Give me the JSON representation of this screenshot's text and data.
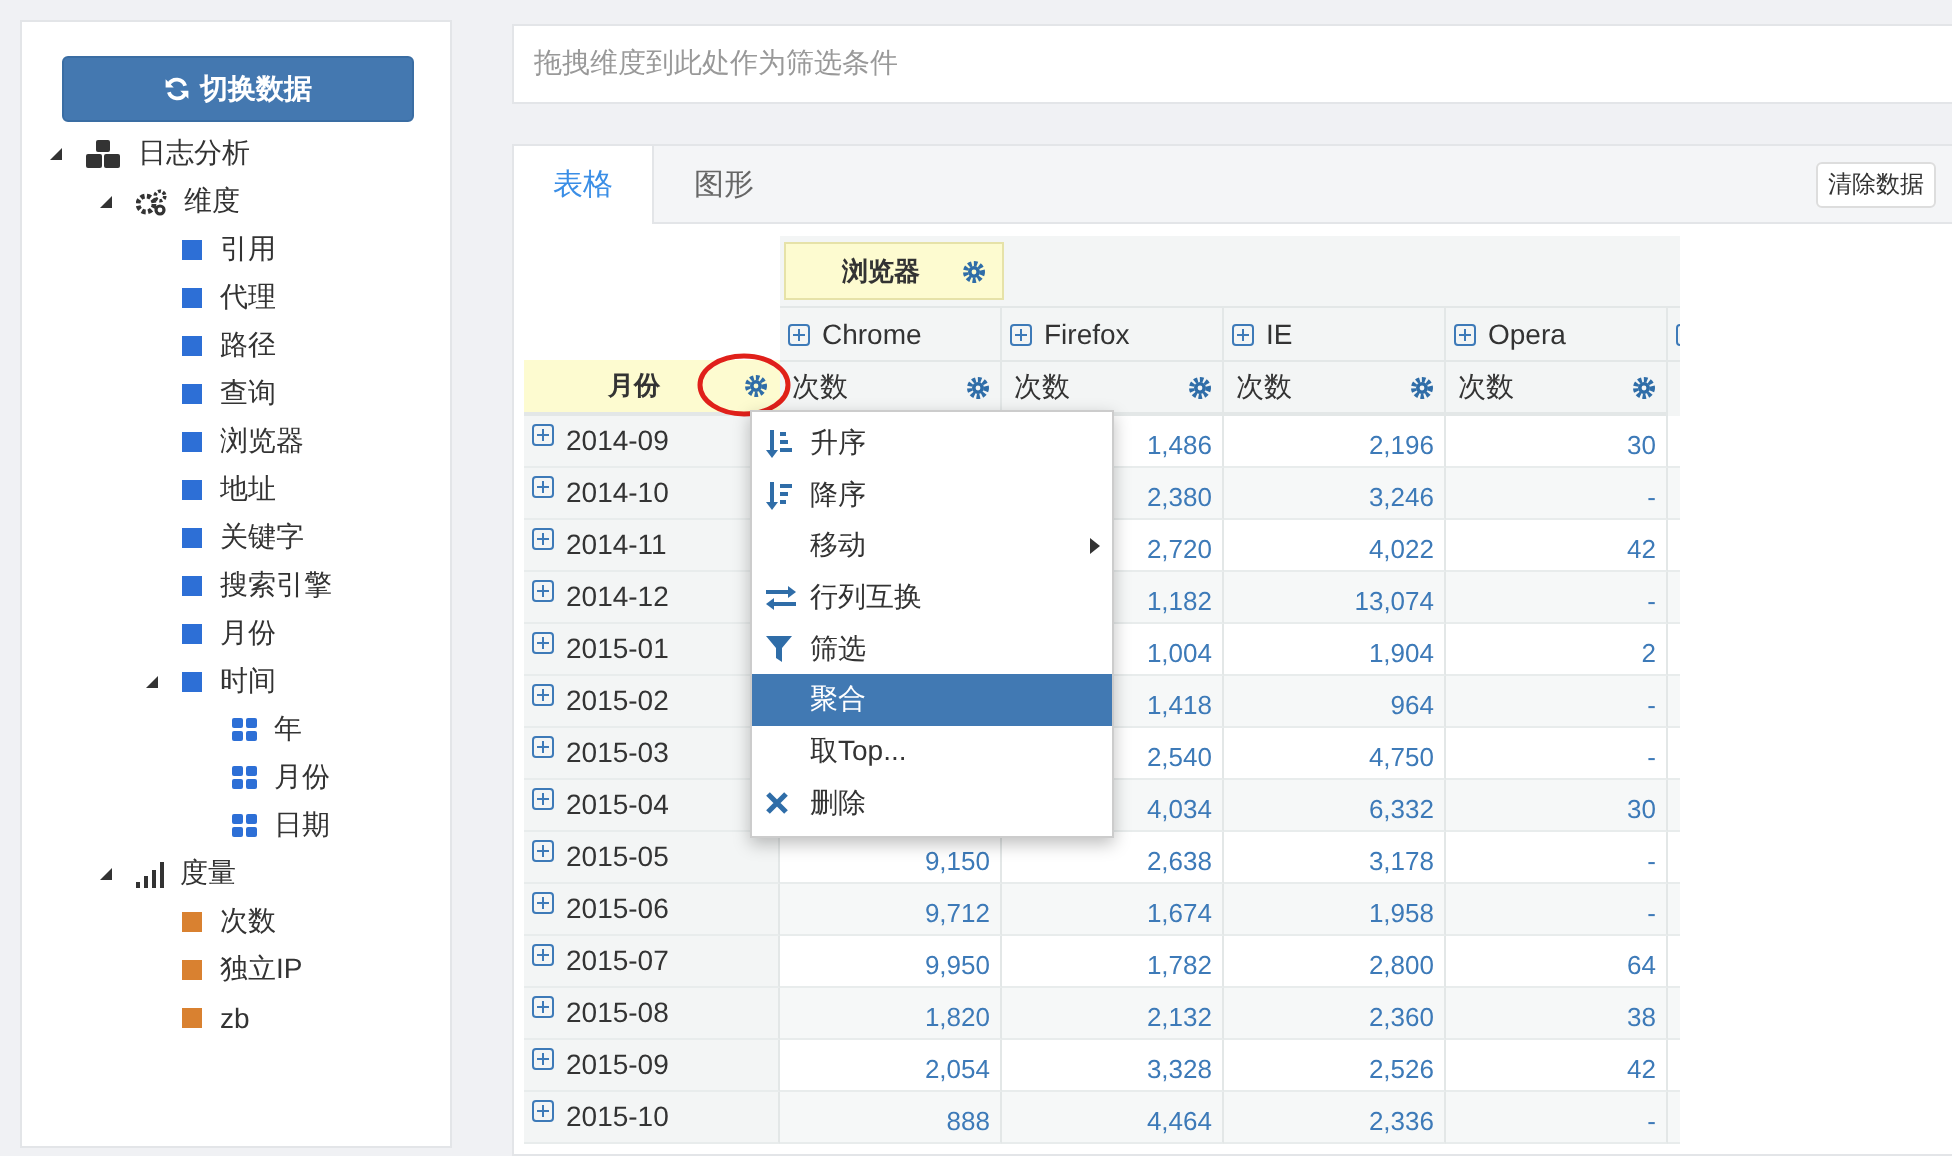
{
  "sidebar": {
    "switch_button": "切换数据",
    "tree": [
      {
        "label": "日志分析",
        "kind": "cube",
        "expanded": true,
        "children": [
          {
            "label": "维度",
            "kind": "gears",
            "expanded": true,
            "children": [
              {
                "label": "引用",
                "kind": "dimension"
              },
              {
                "label": "代理",
                "kind": "dimension"
              },
              {
                "label": "路径",
                "kind": "dimension"
              },
              {
                "label": "查询",
                "kind": "dimension"
              },
              {
                "label": "浏览器",
                "kind": "dimension"
              },
              {
                "label": "地址",
                "kind": "dimension"
              },
              {
                "label": "关键字",
                "kind": "dimension"
              },
              {
                "label": "搜索引擎",
                "kind": "dimension"
              },
              {
                "label": "月份",
                "kind": "dimension"
              },
              {
                "label": "时间",
                "kind": "dimension",
                "expanded": true,
                "children": [
                  {
                    "label": "年",
                    "kind": "level"
                  },
                  {
                    "label": "月份",
                    "kind": "level"
                  },
                  {
                    "label": "日期",
                    "kind": "level"
                  }
                ]
              }
            ]
          },
          {
            "label": "度量",
            "kind": "bars",
            "expanded": true,
            "children": [
              {
                "label": "次数",
                "kind": "measure"
              },
              {
                "label": "独立IP",
                "kind": "measure"
              },
              {
                "label": "zb",
                "kind": "measure"
              }
            ]
          }
        ]
      }
    ]
  },
  "filter_bar": {
    "placeholder": "拖拽维度到此处作为筛选条件"
  },
  "tabs": [
    {
      "label": "表格",
      "selected": true
    },
    {
      "label": "图形",
      "selected": false
    }
  ],
  "clear_button": "清除数据",
  "pivot": {
    "column_dimension": "浏览器",
    "row_dimension": "月份",
    "columns": [
      {
        "name": "Chrome",
        "measure": "次数"
      },
      {
        "name": "Firefox",
        "measure": "次数"
      },
      {
        "name": "IE",
        "measure": "次数"
      },
      {
        "name": "Opera",
        "measure": "次数"
      }
    ],
    "rows": [
      {
        "label": "2014-09",
        "values": [
          "1,486",
          "2,196",
          "30"
        ]
      },
      {
        "label": "2014-10",
        "values": [
          "2,380",
          "3,246",
          "-"
        ]
      },
      {
        "label": "2014-11",
        "values": [
          "2,720",
          "4,022",
          "42"
        ]
      },
      {
        "label": "2014-12",
        "values": [
          "1,182",
          "13,074",
          "-"
        ]
      },
      {
        "label": "2015-01",
        "values": [
          "1,004",
          "1,904",
          "2"
        ]
      },
      {
        "label": "2015-02",
        "values": [
          "1,418",
          "964",
          "-"
        ]
      },
      {
        "label": "2015-03",
        "values": [
          "2,540",
          "4,750",
          "-"
        ]
      },
      {
        "label": "2015-04",
        "values": [
          "4,034",
          "6,332",
          "30"
        ]
      },
      {
        "label": "2015-05",
        "values": [
          "9,150",
          "2,638",
          "3,178",
          "-"
        ]
      },
      {
        "label": "2015-06",
        "values": [
          "9,712",
          "1,674",
          "1,958",
          "-"
        ]
      },
      {
        "label": "2015-07",
        "values": [
          "9,950",
          "1,782",
          "2,800",
          "64"
        ]
      },
      {
        "label": "2015-08",
        "values": [
          "1,820",
          "2,132",
          "2,360",
          "38"
        ]
      },
      {
        "label": "2015-09",
        "values": [
          "2,054",
          "3,328",
          "2,526",
          "42"
        ]
      },
      {
        "label": "2015-10",
        "values": [
          "888",
          "4,464",
          "2,336",
          "-"
        ]
      }
    ]
  },
  "context_menu": {
    "items": [
      {
        "label": "升序",
        "kind": "sort-asc",
        "selected": false
      },
      {
        "label": "降序",
        "kind": "sort-desc",
        "selected": false
      },
      {
        "label": "移动",
        "kind": "submenu",
        "selected": false
      },
      {
        "label": "行列互换",
        "kind": "swap",
        "selected": false
      },
      {
        "label": "筛选",
        "kind": "filter",
        "selected": false
      },
      {
        "label": "聚合",
        "kind": "plain",
        "selected": true
      },
      {
        "label": "取Top...",
        "kind": "plain",
        "selected": false
      },
      {
        "label": "删除",
        "kind": "delete",
        "selected": false
      }
    ]
  }
}
